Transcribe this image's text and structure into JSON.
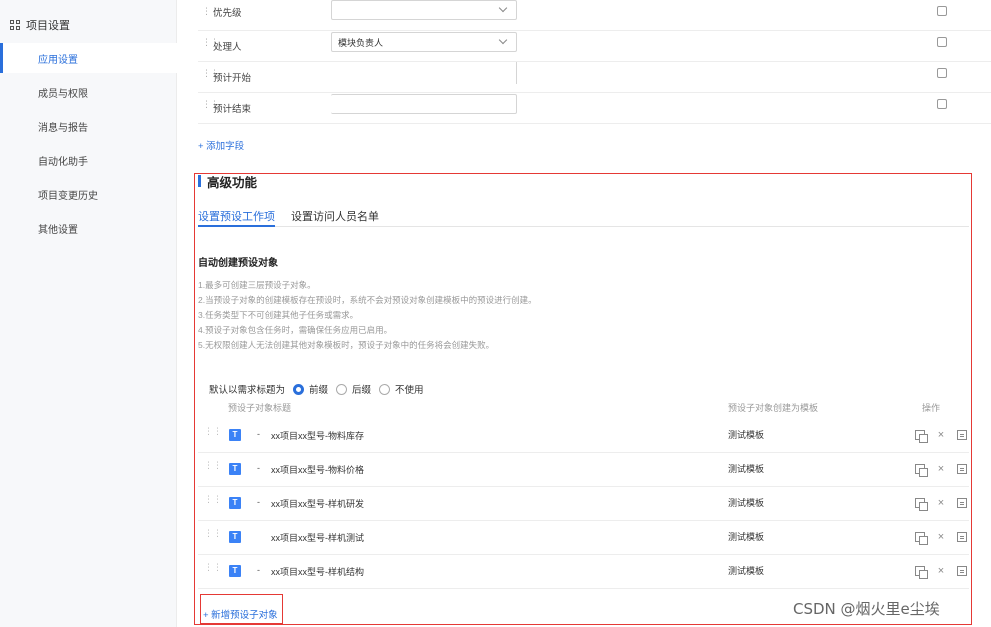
{
  "sidebar": {
    "title": "项目设置",
    "items": [
      {
        "label": "应用设置",
        "active": true
      },
      {
        "label": "成员与权限",
        "active": false
      },
      {
        "label": "消息与报告",
        "active": false
      },
      {
        "label": "自动化助手",
        "active": false
      },
      {
        "label": "项目变更历史",
        "active": false
      },
      {
        "label": "其他设置",
        "active": false
      }
    ]
  },
  "fields": [
    {
      "label": "优先级",
      "value": "",
      "has_dropdown": true
    },
    {
      "label": "处理人",
      "value": "模块负责人",
      "has_dropdown": true
    },
    {
      "label": "预计开始",
      "value": "",
      "has_dropdown": false
    },
    {
      "label": "预计结束",
      "value": "",
      "has_dropdown": false
    }
  ],
  "add_field_label": "+ 添加字段",
  "advanced": {
    "title": "高级功能",
    "tabs": [
      {
        "label": "设置预设工作项",
        "active": true
      },
      {
        "label": "设置访问人员名单",
        "active": false
      }
    ],
    "subtitle": "自动创建预设对象",
    "rules": [
      "1.最多可创建三层预设子对象。",
      "2.当预设子对象的创建模板存在预设时，系统不会对预设对象创建模板中的预设进行创建。",
      "3.任务类型下不可创建其他子任务或需求。",
      "4.预设子对象包含任务时，需确保任务应用已启用。",
      "5.无权限创建人无法创建其他对象模板时，预设子对象中的任务将会创建失败。"
    ],
    "radio_label": "默认以需求标题为",
    "radio_options": [
      {
        "label": "前缀",
        "selected": true
      },
      {
        "label": "后缀",
        "selected": false
      },
      {
        "label": "不使用",
        "selected": false
      }
    ],
    "columns": {
      "title": "预设子对象标题",
      "template": "预设子对象创建为模板",
      "actions": "操作"
    },
    "rows": [
      {
        "type": "T",
        "dash": "-",
        "name": "xx项目xx型号-物料库存",
        "template": "测试模板"
      },
      {
        "type": "T",
        "dash": "-",
        "name": "xx项目xx型号-物料价格",
        "template": "测试模板"
      },
      {
        "type": "T",
        "dash": "-",
        "name": "xx项目xx型号-样机研发",
        "template": "测试模板"
      },
      {
        "type": "T",
        "dash": "",
        "name": "xx项目xx型号-样机测试",
        "template": "测试模板"
      },
      {
        "type": "T",
        "dash": "-",
        "name": "xx项目xx型号-样机结构",
        "template": "测试模板"
      }
    ],
    "add_object_label": "+ 新增预设子对象"
  },
  "watermark": "CSDN @烟火里e尘埃",
  "colors": {
    "accent": "#2a6fdb",
    "highlight_box": "#e53935",
    "badge": "#3b82f6"
  }
}
